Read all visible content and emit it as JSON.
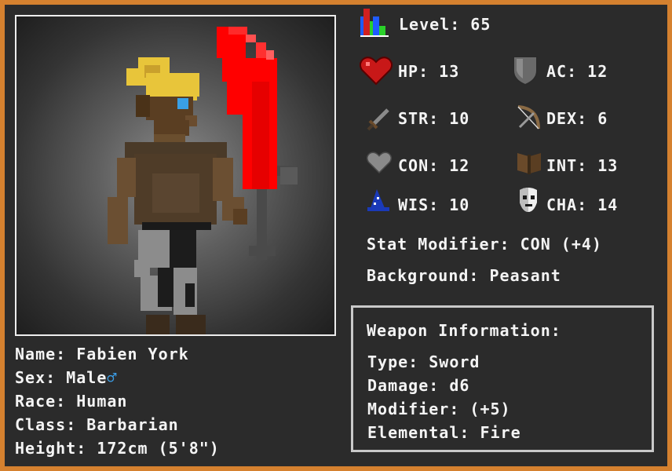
{
  "level": {
    "label": "Level:",
    "value": "65"
  },
  "stats": {
    "hp": {
      "label": "HP:",
      "value": "13"
    },
    "ac": {
      "label": "AC:",
      "value": "12"
    },
    "str": {
      "label": "STR:",
      "value": "10"
    },
    "dex": {
      "label": "DEX:",
      "value": "6"
    },
    "con": {
      "label": "CON:",
      "value": "12"
    },
    "int": {
      "label": "INT:",
      "value": "13"
    },
    "wis": {
      "label": "WIS:",
      "value": "10"
    },
    "cha": {
      "label": "CHA:",
      "value": "14"
    }
  },
  "stat_modifier": {
    "label": "Stat Modifier:",
    "value": "CON (+4)"
  },
  "background": {
    "label": "Background:",
    "value": "Peasant"
  },
  "weapon": {
    "title": "Weapon Information:",
    "type": {
      "label": "Type:",
      "value": "Sword"
    },
    "damage": {
      "label": "Damage:",
      "value": "d6"
    },
    "modifier": {
      "label": "Modifier:",
      "value": "(+5)"
    },
    "elemental": {
      "label": "Elemental:",
      "value": "Fire"
    }
  },
  "character": {
    "name": {
      "label": "Name:",
      "value": "Fabien York"
    },
    "sex": {
      "label": "Sex:",
      "value": "Male",
      "symbol": "♂"
    },
    "race": {
      "label": "Race:",
      "value": "Human"
    },
    "class": {
      "label": "Class:",
      "value": "Barbarian"
    },
    "height": {
      "label": "Height:",
      "value": "172cm (5'8\")"
    }
  },
  "icons": {
    "level": "bar-chart-icon",
    "hp": "heart-icon",
    "ac": "shield-icon",
    "str": "sword-icon",
    "dex": "bow-icon",
    "con": "gray-heart-icon",
    "int": "book-icon",
    "wis": "wizard-hat-icon",
    "cha": "mask-icon"
  },
  "colors": {
    "frame": "#d5812f",
    "panel": "#2b2b2b",
    "text": "#f4f4f4",
    "fire": "#ff0000",
    "male_symbol": "#3b9ee8"
  }
}
